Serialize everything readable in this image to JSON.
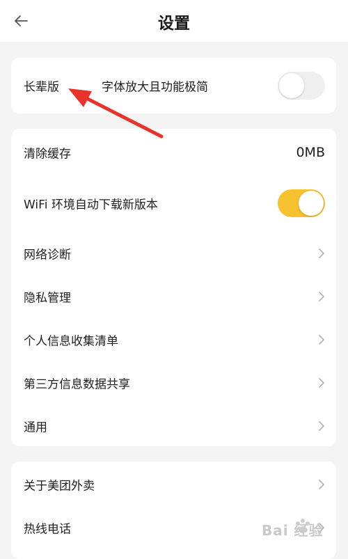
{
  "header": {
    "title": "设置"
  },
  "elder": {
    "label": "长辈版",
    "description": "字体放大且功能极简",
    "enabled": false
  },
  "settings": {
    "clear_cache_label": "清除缓存",
    "cache_size": "0MB",
    "wifi_update_label": "WiFi 环境自动下载新版本",
    "wifi_update_enabled": true,
    "network_diagnosis": "网络诊断",
    "privacy_management": "隐私管理",
    "personal_info_list": "个人信息收集清单",
    "third_party_sharing": "第三方信息数据共享",
    "general": "通用"
  },
  "about": {
    "about_label": "关于美团外卖",
    "hotline_label": "热线电话"
  },
  "watermark": {
    "text": "Bai 经验"
  },
  "colors": {
    "toggle_on": "#f6c230",
    "annotation_arrow": "#e8332b"
  }
}
